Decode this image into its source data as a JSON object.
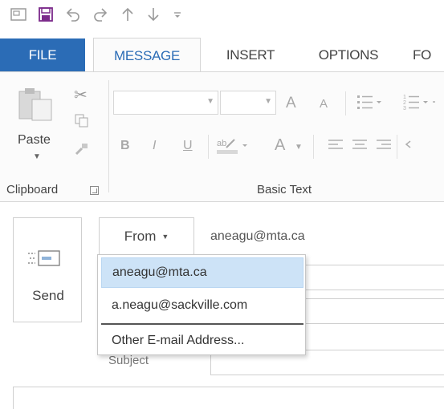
{
  "quick_access": {
    "icons": [
      "outlook-icon",
      "save-icon",
      "undo-icon",
      "redo-icon",
      "up-arrow-icon",
      "down-arrow-icon",
      "customize-icon"
    ]
  },
  "tabs": [
    {
      "label": "FILE",
      "active": false
    },
    {
      "label": "MESSAGE",
      "active": true
    },
    {
      "label": "INSERT",
      "active": false
    },
    {
      "label": "OPTIONS",
      "active": false
    },
    {
      "label": "FO",
      "active": false
    }
  ],
  "ribbon": {
    "clipboard": {
      "paste_label": "Paste",
      "group_label": "Clipboard"
    },
    "basic_text": {
      "group_label": "Basic Text",
      "grow_font": "A",
      "shrink_font": "A",
      "bold": "B",
      "italic": "I",
      "underline": "U",
      "font_color": "A"
    }
  },
  "compose": {
    "send_label": "Send",
    "from_label": "From",
    "from_email": "aneagu@mta.ca",
    "subject_label": "Subject"
  },
  "from_menu": {
    "items": [
      {
        "label": "aneagu@mta.ca",
        "selected": true
      },
      {
        "label": "a.neagu@sackville.com",
        "selected": false
      },
      {
        "label": "Other E-mail Address...",
        "selected": false
      }
    ]
  },
  "colors": {
    "file_tab": "#2b6cb6",
    "accent": "#2b6cb6",
    "menu_highlight": "#cde3f7",
    "save_icon": "#7b2a8a"
  }
}
